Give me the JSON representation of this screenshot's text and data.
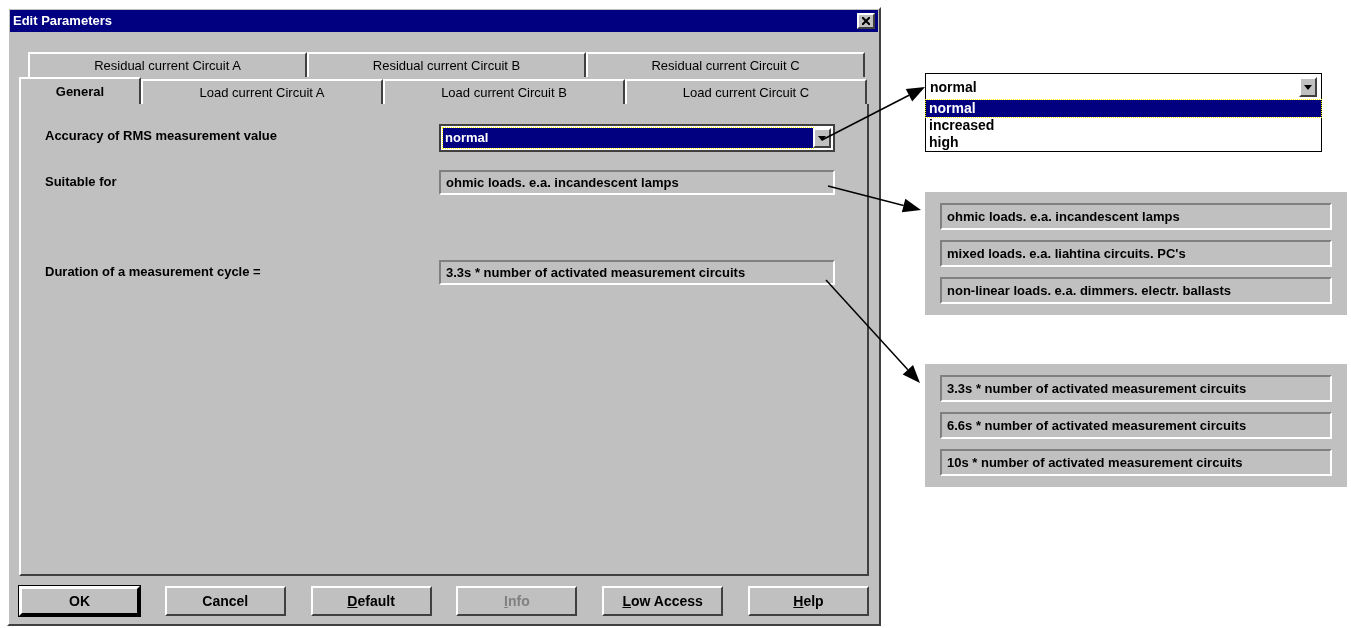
{
  "window": {
    "title": "Edit Parameters"
  },
  "tab_rows": [
    [
      {
        "label": "Residual current Circuit A",
        "selected": false
      },
      {
        "label": "Residual current Circuit B",
        "selected": false
      },
      {
        "label": "Residual current Circuit C",
        "selected": false
      }
    ],
    [
      {
        "label": "General",
        "selected": true
      },
      {
        "label": "Load current Circuit A",
        "selected": false
      },
      {
        "label": "Load current Circuit B",
        "selected": false
      },
      {
        "label": "Load current Circuit C",
        "selected": false
      }
    ]
  ],
  "fields": [
    {
      "kind": "dropdown",
      "label": "Accuracy of RMS measurement value",
      "value": "normal",
      "focused": true
    },
    {
      "kind": "readonly",
      "label": "Suitable for",
      "value": "ohmic loads. e.a. incandescent lamps"
    },
    {
      "kind": "readonly",
      "label": "Duration of a measurement cycle =",
      "value": "3.3s * number of activated measurement circuits"
    }
  ],
  "buttons": [
    {
      "label": "OK",
      "default": true,
      "disabled": false,
      "underline_first": false
    },
    {
      "label": "Cancel",
      "default": false,
      "disabled": false,
      "underline_first": false
    },
    {
      "label": "Default",
      "default": false,
      "disabled": false,
      "underline_first": true
    },
    {
      "label": "Info",
      "default": false,
      "disabled": true,
      "underline_first": true
    },
    {
      "label": "Low Access",
      "default": false,
      "disabled": false,
      "underline_first": true
    },
    {
      "label": "Help",
      "default": false,
      "disabled": false,
      "underline_first": true
    }
  ],
  "dropdown_callout": {
    "value": "normal",
    "options": [
      {
        "label": "normal",
        "selected": true
      },
      {
        "label": "increased",
        "selected": false
      },
      {
        "label": "high",
        "selected": false
      }
    ]
  },
  "suitable_callout": {
    "options": [
      "ohmic loads. e.a. incandescent lamps",
      "mixed loads. e.a. liahtina circuits. PC's",
      "non-linear loads. e.a. dimmers. electr. ballasts"
    ]
  },
  "duration_callout": {
    "options": [
      "3.3s * number of activated measurement circuits",
      "6.6s * number of activated measurement circuits",
      "10s * number of activated measurement circuits"
    ]
  }
}
